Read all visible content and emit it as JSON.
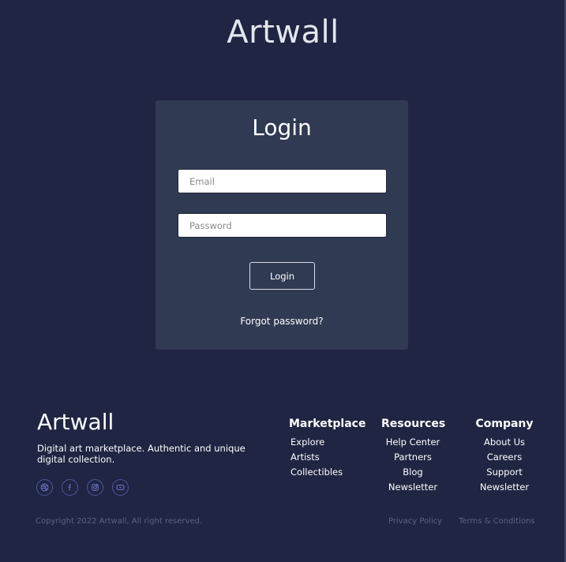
{
  "header": {
    "brand": "Artwall"
  },
  "login": {
    "title": "Login",
    "email_placeholder": "Email",
    "password_placeholder": "Password",
    "submit_label": "Login",
    "forgot_label": "Forgot password?"
  },
  "footer": {
    "brand": "Artwall",
    "tagline": "Digital art marketplace. Authentic and unique digital collection.",
    "socials": [
      "dribbble-icon",
      "facebook-icon",
      "instagram-icon",
      "youtube-icon"
    ],
    "columns": [
      {
        "title": "Marketplace",
        "links": [
          "Explore",
          "Artists",
          "Collectibles"
        ]
      },
      {
        "title": "Resources",
        "links": [
          "Help Center",
          "Partners",
          "Blog",
          "Newsletter"
        ]
      },
      {
        "title": "Company",
        "links": [
          "About Us",
          "Careers",
          "Support",
          "Newsletter"
        ]
      }
    ],
    "copyright": "Copyright 2022  Artwall, All right reserved.",
    "privacy": "Privacy Policy",
    "terms": "Terms & Conditions"
  },
  "colors": {
    "background": "#1f2542",
    "card": "#303a52",
    "social_accent": "#4d56a4",
    "muted_text": "#5b6383"
  }
}
